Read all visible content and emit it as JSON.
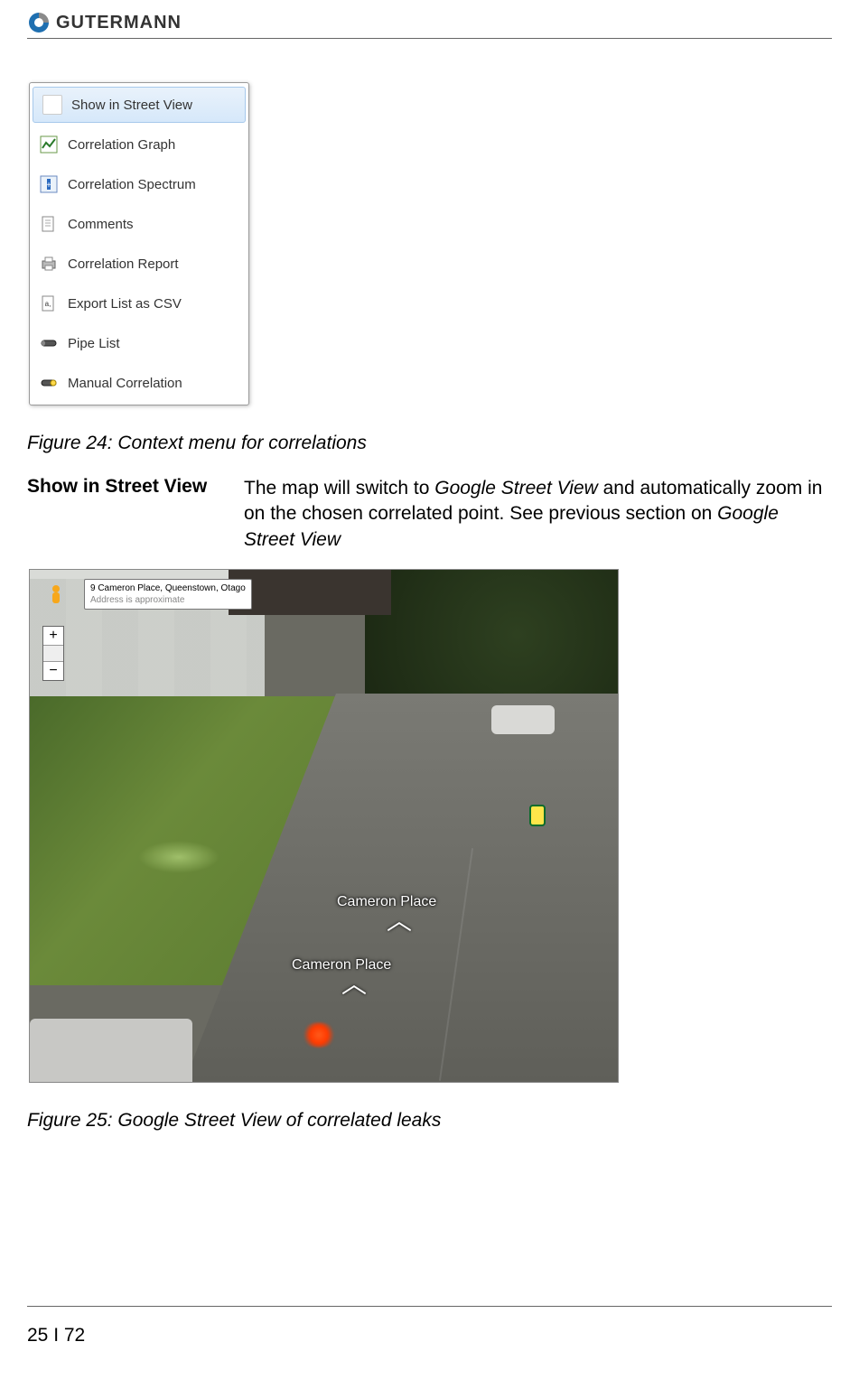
{
  "header": {
    "brand": "GUTERMANN"
  },
  "context_menu": {
    "items": [
      {
        "label": "Show in Street View",
        "icon": "blank",
        "selected": true
      },
      {
        "label": "Correlation Graph",
        "icon": "chart"
      },
      {
        "label": "Correlation Spectrum",
        "icon": "spectrum"
      },
      {
        "label": "Comments",
        "icon": "comments"
      },
      {
        "label": "Correlation Report",
        "icon": "printer"
      },
      {
        "label": "Export List as CSV",
        "icon": "csv"
      },
      {
        "label": "Pipe List",
        "icon": "pipe"
      },
      {
        "label": "Manual Correlation",
        "icon": "manual"
      }
    ]
  },
  "caption1": "Figure 24:  Context menu for correlations",
  "desc": {
    "label": "Show in Street View",
    "part1": "The map will switch to ",
    "em1": "Google Street View",
    "part2": " and automatically zoom in on the chosen correlated point. See previous section on ",
    "em2": "Google Street View"
  },
  "streetview": {
    "address_line1": "9 Cameron Place, Queenstown, Otago",
    "address_line2": "Address is approximate",
    "road_label": "Cameron Place",
    "zoom_plus": "+",
    "zoom_minus": "−"
  },
  "caption2": "Figure 25: Google Street View of correlated leaks",
  "footer": {
    "page": "25 I 72"
  }
}
